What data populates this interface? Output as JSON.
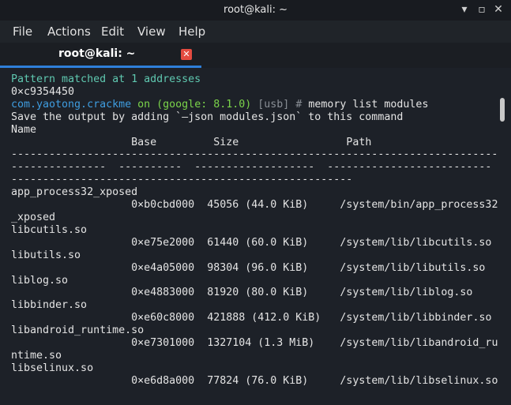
{
  "window": {
    "title": "root@kali: ~",
    "controls": {
      "minimize": "▾",
      "maximize": "▫",
      "close": "✕"
    }
  },
  "menu": [
    "File",
    "Actions",
    "Edit",
    "View",
    "Help"
  ],
  "tab": {
    "label": "root@kali: ~",
    "close_icon": "✕"
  },
  "terminal": {
    "pattern_line": "Pattern matched at 1 addresses",
    "address_line": "0×c9354450",
    "prompt": {
      "app": "com.yaotong.crackme",
      "on": "on",
      "device": "(google: 8.1.0)",
      "conn": "[usb]",
      "hash": "#",
      "command": "memory list modules"
    },
    "hint": "Save the output by adding `—json modules.json` to this command",
    "table": {
      "headers": {
        "name": "Name",
        "base": "Base",
        "size": "Size",
        "path": "Path"
      },
      "separator": "-----------------------------------------------------------------------------\n---------------  ----------  -------------------  --------------------------\n------------------------------------------------------",
      "rows": [
        {
          "name": "app_process32_xposed",
          "base": "0×b0cbd000",
          "size": "45056 (44.0 KiB)",
          "path": "/system/bin/app_process32",
          "path_wrap": "_xposed"
        },
        {
          "name": "libcutils.so",
          "base": "0×e75e2000",
          "size": "61440 (60.0 KiB)",
          "path": "/system/lib/libcutils.so",
          "path_wrap": ""
        },
        {
          "name": "libutils.so",
          "base": "0×e4a05000",
          "size": "98304 (96.0 KiB)",
          "path": "/system/lib/libutils.so",
          "path_wrap": ""
        },
        {
          "name": "liblog.so",
          "base": "0×e4883000",
          "size": "81920 (80.0 KiB)",
          "path": "/system/lib/liblog.so",
          "path_wrap": ""
        },
        {
          "name": "libbinder.so",
          "base": "0×e60c8000",
          "size": "421888 (412.0 KiB)",
          "path": "/system/lib/libbinder.so",
          "path_wrap": ""
        },
        {
          "name": "libandroid_runtime.so",
          "base": "0×e7301000",
          "size": "1327104 (1.3 MiB)",
          "path": "/system/lib/libandroid_ru",
          "path_wrap": "ntime.so"
        },
        {
          "name": "libselinux.so",
          "base": "0×e6d8a000",
          "size": "77824 (76.0 KiB)",
          "path": "/system/lib/libselinux.so",
          "path_wrap": ""
        }
      ]
    }
  },
  "colors": {
    "background": "#1d2128",
    "accent": "#2f7fd9",
    "prompt_app": "#3f9de0",
    "prompt_device": "#7bd44a",
    "info_text": "#5fc8b0",
    "tab_close": "#e44b40"
  },
  "scroll_position_fraction": 0.0
}
